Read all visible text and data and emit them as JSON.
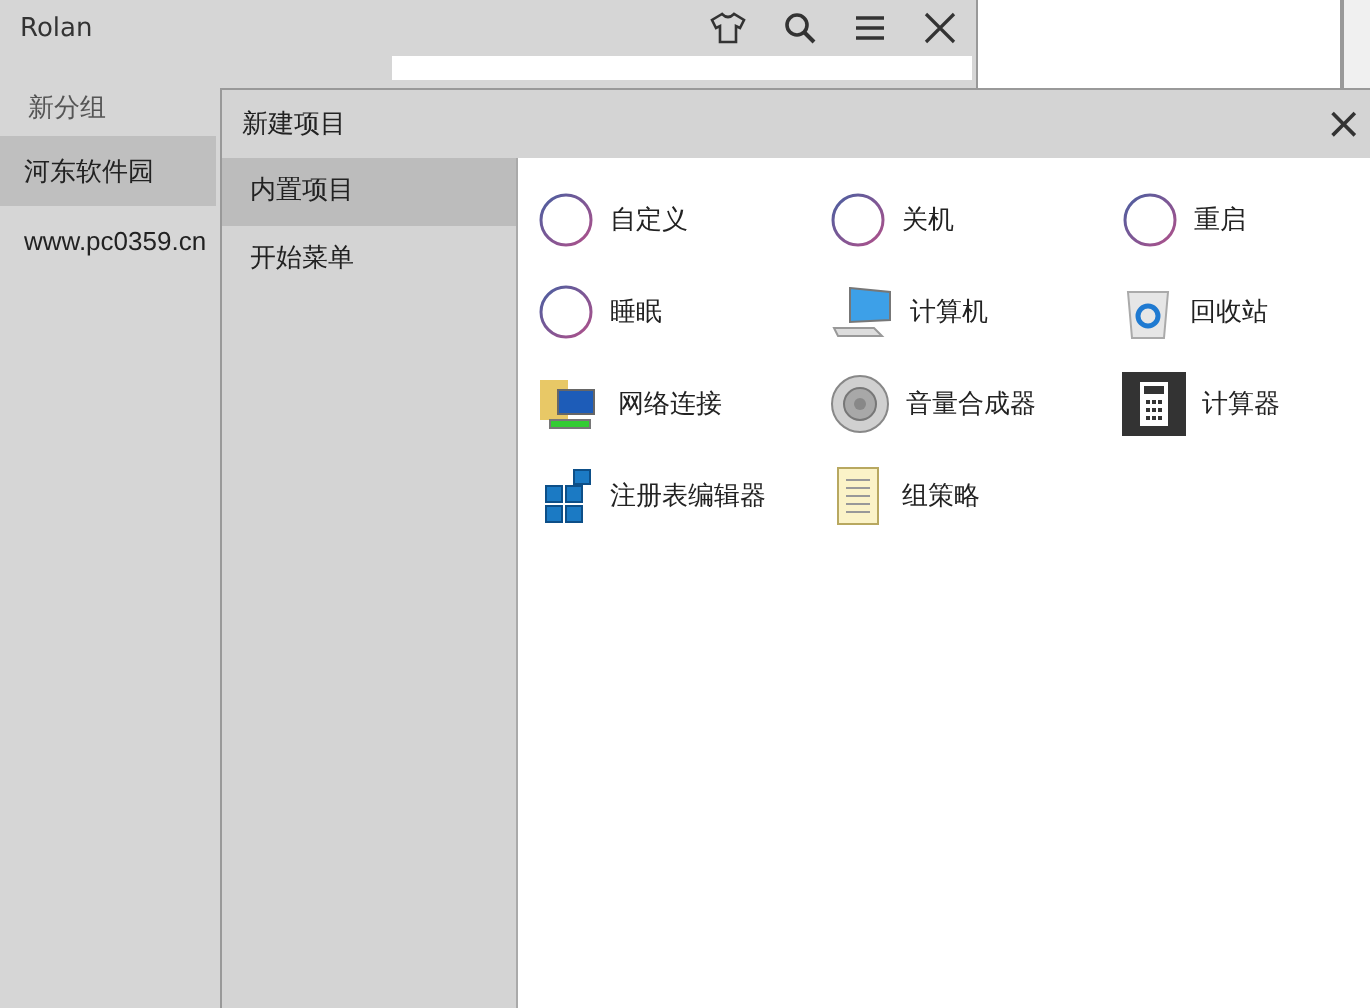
{
  "main_window": {
    "title": "Rolan",
    "group_header": "新分组",
    "groups": [
      {
        "label": "河东软件园",
        "selected": true
      },
      {
        "label": "www.pc0359.cn",
        "selected": false
      }
    ]
  },
  "dialog": {
    "title": "新建项目",
    "close": "×",
    "categories": [
      {
        "label": "内置项目",
        "selected": true
      },
      {
        "label": "开始菜单",
        "selected": false
      }
    ],
    "items": [
      {
        "label": "自定义",
        "kind": "circle"
      },
      {
        "label": "关机",
        "kind": "circle"
      },
      {
        "label": "重启",
        "kind": "circle"
      },
      {
        "label": "睡眠",
        "kind": "circle"
      },
      {
        "label": "计算机",
        "kind": "monitor"
      },
      {
        "label": "回收站",
        "kind": "recycle"
      },
      {
        "label": "网络连接",
        "kind": "network"
      },
      {
        "label": "音量合成器",
        "kind": "speaker"
      },
      {
        "label": "计算器",
        "kind": "calculator"
      },
      {
        "label": "注册表编辑器",
        "kind": "registry"
      },
      {
        "label": "组策略",
        "kind": "scroll"
      }
    ]
  }
}
